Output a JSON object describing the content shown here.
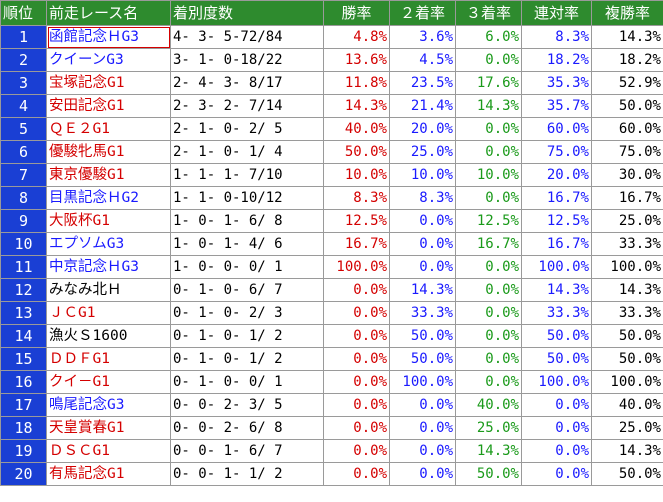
{
  "colors": {
    "header_bg": "#2e8b2e",
    "rank_bg": "#1a3fd4",
    "red": "#d40000",
    "blue": "#1a1aff",
    "green": "#1a9a1a",
    "black": "#000000"
  },
  "chart_data": {
    "type": "table",
    "columns": [
      "順位",
      "前走レース名",
      "着別度数",
      "勝率",
      "２着率",
      "３着率",
      "連対率",
      "複勝率"
    ],
    "rows": [
      {
        "rank": "1",
        "race": "函館記念ＨG3",
        "race_color": "blue",
        "record": "4- 3- 5-72/84",
        "win": "4.8%",
        "place2": "3.6%",
        "place3": "6.0%",
        "rentai": "8.3%",
        "fukusho": "14.3%"
      },
      {
        "rank": "2",
        "race": "クイーンG3",
        "race_color": "blue",
        "record": "3- 1- 0-18/22",
        "win": "13.6%",
        "place2": "4.5%",
        "place3": "0.0%",
        "rentai": "18.2%",
        "fukusho": "18.2%"
      },
      {
        "rank": "3",
        "race": "宝塚記念G1",
        "race_color": "red",
        "record": "2- 4- 3- 8/17",
        "win": "11.8%",
        "place2": "23.5%",
        "place3": "17.6%",
        "rentai": "35.3%",
        "fukusho": "52.9%"
      },
      {
        "rank": "4",
        "race": "安田記念G1",
        "race_color": "red",
        "record": "2- 3- 2- 7/14",
        "win": "14.3%",
        "place2": "21.4%",
        "place3": "14.3%",
        "rentai": "35.7%",
        "fukusho": "50.0%"
      },
      {
        "rank": "5",
        "race": "ＱＥ２G1",
        "race_color": "red",
        "record": "2- 1- 0- 2/ 5",
        "win": "40.0%",
        "place2": "20.0%",
        "place3": "0.0%",
        "rentai": "60.0%",
        "fukusho": "60.0%"
      },
      {
        "rank": "6",
        "race": "優駿牝馬G1",
        "race_color": "red",
        "record": "2- 1- 0- 1/ 4",
        "win": "50.0%",
        "place2": "25.0%",
        "place3": "0.0%",
        "rentai": "75.0%",
        "fukusho": "75.0%"
      },
      {
        "rank": "7",
        "race": "東京優駿G1",
        "race_color": "red",
        "record": "1- 1- 1- 7/10",
        "win": "10.0%",
        "place2": "10.0%",
        "place3": "10.0%",
        "rentai": "20.0%",
        "fukusho": "30.0%"
      },
      {
        "rank": "8",
        "race": "目黒記念ＨG2",
        "race_color": "blue",
        "record": "1- 1- 0-10/12",
        "win": "8.3%",
        "place2": "8.3%",
        "place3": "0.0%",
        "rentai": "16.7%",
        "fukusho": "16.7%"
      },
      {
        "rank": "9",
        "race": "大阪杯G1",
        "race_color": "red",
        "record": "1- 0- 1- 6/ 8",
        "win": "12.5%",
        "place2": "0.0%",
        "place3": "12.5%",
        "rentai": "12.5%",
        "fukusho": "25.0%"
      },
      {
        "rank": "10",
        "race": "エプソムG3",
        "race_color": "blue",
        "record": "1- 0- 1- 4/ 6",
        "win": "16.7%",
        "place2": "0.0%",
        "place3": "16.7%",
        "rentai": "16.7%",
        "fukusho": "33.3%"
      },
      {
        "rank": "11",
        "race": "中京記念ＨG3",
        "race_color": "blue",
        "record": "1- 0- 0- 0/ 1",
        "win": "100.0%",
        "place2": "0.0%",
        "place3": "0.0%",
        "rentai": "100.0%",
        "fukusho": "100.0%"
      },
      {
        "rank": "12",
        "race": "みなみ北Ｈ",
        "race_color": "black",
        "record": "0- 1- 0- 6/ 7",
        "win": "0.0%",
        "place2": "14.3%",
        "place3": "0.0%",
        "rentai": "14.3%",
        "fukusho": "14.3%"
      },
      {
        "rank": "13",
        "race": "ＪＣG1",
        "race_color": "red",
        "record": "0- 1- 0- 2/ 3",
        "win": "0.0%",
        "place2": "33.3%",
        "place3": "0.0%",
        "rentai": "33.3%",
        "fukusho": "33.3%"
      },
      {
        "rank": "14",
        "race": "漁火Ｓ1600",
        "race_color": "black",
        "record": "0- 1- 0- 1/ 2",
        "win": "0.0%",
        "place2": "50.0%",
        "place3": "0.0%",
        "rentai": "50.0%",
        "fukusho": "50.0%"
      },
      {
        "rank": "15",
        "race": "ＤＤＦG1",
        "race_color": "red",
        "record": "0- 1- 0- 1/ 2",
        "win": "0.0%",
        "place2": "50.0%",
        "place3": "0.0%",
        "rentai": "50.0%",
        "fukusho": "50.0%"
      },
      {
        "rank": "16",
        "race": "クイ－G1",
        "race_color": "red",
        "record": "0- 1- 0- 0/ 1",
        "win": "0.0%",
        "place2": "100.0%",
        "place3": "0.0%",
        "rentai": "100.0%",
        "fukusho": "100.0%"
      },
      {
        "rank": "17",
        "race": "鳴尾記念G3",
        "race_color": "blue",
        "record": "0- 0- 2- 3/ 5",
        "win": "0.0%",
        "place2": "0.0%",
        "place3": "40.0%",
        "rentai": "0.0%",
        "fukusho": "40.0%"
      },
      {
        "rank": "18",
        "race": "天皇賞春G1",
        "race_color": "red",
        "record": "0- 0- 2- 6/ 8",
        "win": "0.0%",
        "place2": "0.0%",
        "place3": "25.0%",
        "rentai": "0.0%",
        "fukusho": "25.0%"
      },
      {
        "rank": "19",
        "race": "ＤＳＣG1",
        "race_color": "red",
        "record": "0- 0- 1- 6/ 7",
        "win": "0.0%",
        "place2": "0.0%",
        "place3": "14.3%",
        "rentai": "0.0%",
        "fukusho": "14.3%"
      },
      {
        "rank": "20",
        "race": "有馬記念G1",
        "race_color": "red",
        "record": "0- 0- 1- 1/ 2",
        "win": "0.0%",
        "place2": "0.0%",
        "place3": "50.0%",
        "rentai": "0.0%",
        "fukusho": "50.0%"
      }
    ]
  }
}
